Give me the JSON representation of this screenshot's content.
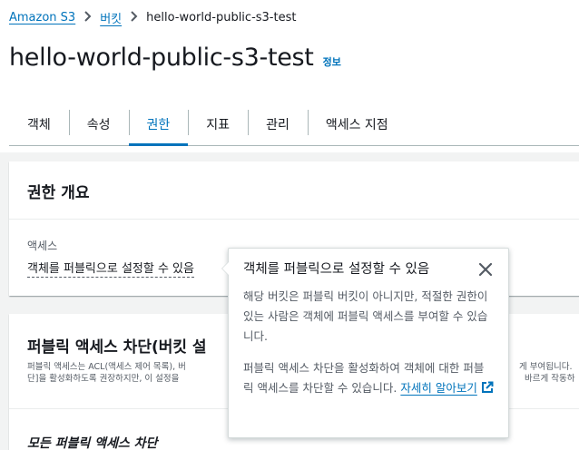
{
  "breadcrumb": {
    "root": "Amazon S3",
    "buckets": "버킷",
    "current": "hello-world-public-s3-test"
  },
  "page": {
    "title": "hello-world-public-s3-test",
    "info": "정보"
  },
  "tabs": [
    {
      "label": "객체"
    },
    {
      "label": "속성"
    },
    {
      "label": "권한"
    },
    {
      "label": "지표"
    },
    {
      "label": "관리"
    },
    {
      "label": "액세스 지점"
    }
  ],
  "active_tab": "권한",
  "permissions_overview": {
    "title": "권한 개요",
    "access_label": "액세스",
    "access_value": "객체를 퍼블릭으로 설정할 수 있음"
  },
  "block_public_access": {
    "title": "퍼블릭 액세스 차단(버킷 설",
    "desc_line1": "퍼블릭 액세스는 ACL(액세스 제어 목록), 버",
    "desc_line1_end": "게 부여됩니다.",
    "desc_line2": "단]을 활성화하도록 권장하지만, 이 설정을",
    "desc_line2_end": "바르게 작동하",
    "subsection": "모든 퍼블릭 액세스 차단"
  },
  "popover": {
    "title": "객체를 퍼블릭으로 설정할 수 있음",
    "para1": "해당 버킷은 퍼블릭 버킷이 아니지만, 적절한 권한이 있는 사람은 객체에 퍼블릭 액세스를 부여할 수 있습니다.",
    "para2": "퍼블릭 액세스 차단을 활성화하여 객체에 대한 퍼블릭 액세스를 차단할 수 있습니다.",
    "learn_more": "자세히 알아보기"
  },
  "colors": {
    "link": "#0073bb",
    "text": "#16191f",
    "muted": "#545b64",
    "background": "#f2f3f3"
  },
  "icons": [
    "chevron-right-icon",
    "close-icon",
    "external-link-icon"
  ]
}
